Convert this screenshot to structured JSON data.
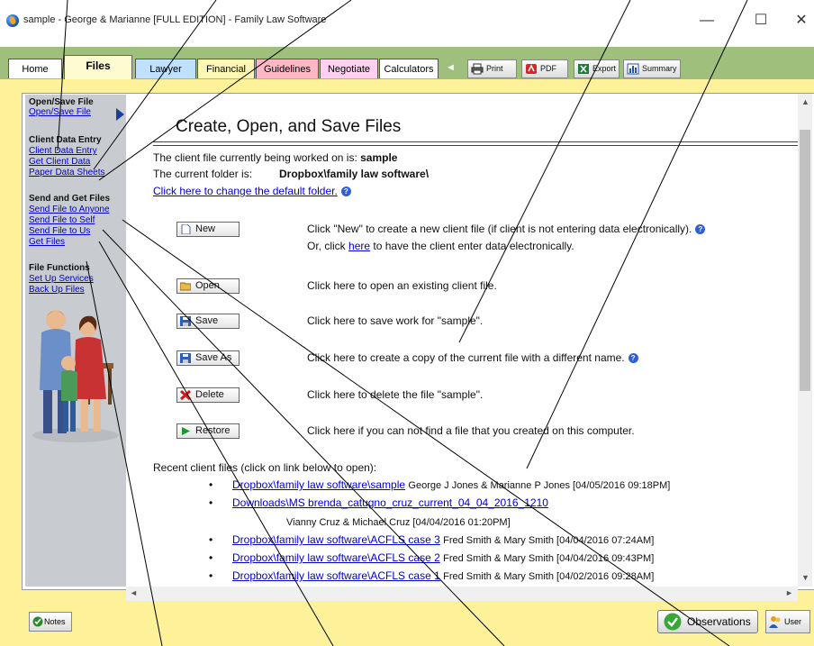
{
  "window": {
    "title": "sample - George & Marianne [FULL EDITION] - Family Law Software",
    "minimize_glyph": "—",
    "maximize_glyph": "☐",
    "close_glyph": "✕"
  },
  "tabs": [
    {
      "label": "Home",
      "color": "#ffffff"
    },
    {
      "label": "Files",
      "color": "#fffbd1"
    },
    {
      "label": "Lawyer",
      "color": "#bfe0ff"
    },
    {
      "label": "Financial",
      "color": "#fff8b5"
    },
    {
      "label": "Guidelines",
      "color": "#ffb7c5"
    },
    {
      "label": "Negotiate",
      "color": "#ffd0f0"
    },
    {
      "label": "Calculators",
      "color": "#ffffff"
    }
  ],
  "toolbar": {
    "nav_arrow": "◄",
    "print": "Print",
    "pdf": "PDF",
    "export": "Export",
    "summary": "Summary"
  },
  "sidebar": {
    "sections": [
      {
        "heading": "Open/Save File",
        "links": [
          "Open/Save File"
        ]
      },
      {
        "heading": "Client Data Entry",
        "links": [
          "Client Data Entry",
          "Get Client Data",
          "Paper Data Sheets"
        ]
      },
      {
        "heading": "Send and Get Files",
        "links": [
          "Send File to Anyone",
          "Send File to Self",
          "Send File to Us",
          "Get Files"
        ]
      },
      {
        "heading": "File Functions",
        "links": [
          "Set Up Services",
          "Back Up Files"
        ]
      }
    ]
  },
  "main": {
    "title": "Create, Open, and Save Files",
    "current_file_prefix": "The client file currently being worked on is: ",
    "current_file": "sample",
    "current_folder_prefix": "The current folder is:",
    "current_folder": "Dropbox\\family law software\\",
    "change_folder_link": "Click here to change the default folder.",
    "actions": [
      {
        "label": "New",
        "description": "Click \"New\" to create a new client file (if client is not entering data electronically).",
        "help": true
      },
      {
        "label": "Open",
        "description": "Click here to open an existing client file.",
        "help": false
      },
      {
        "label": "Save",
        "description": "Click here to save work for \"sample\".",
        "help": false
      },
      {
        "label": "Save As",
        "description": "Click here to create a copy of the current file with a different name.",
        "help": true
      },
      {
        "label": "Delete",
        "description": "Click here to delete the file \"sample\".",
        "help": false
      },
      {
        "label": "Restore",
        "description": "Click here if you can not find a file that you created on this computer.",
        "help": false
      }
    ],
    "new_or_prefix": "Or, click ",
    "new_or_link": "here",
    "new_or_suffix": " to have the client enter data electronically.",
    "recent_heading": "Recent client files (click on link below to open):",
    "recent_files": [
      {
        "link": "Dropbox\\family law software\\sample",
        "meta": "George J Jones & Marianne P Jones [04/05/2016 09:18PM]"
      },
      {
        "link": "Downloads\\MS brenda_catugno_cruz_current_04_04_2016_1210",
        "meta": "Vianny Cruz & Michael Cruz [04/04/2016 01:20PM]"
      },
      {
        "link": "Dropbox\\family law software\\ACFLS case 3",
        "meta": "Fred Smith & Mary Smith [04/04/2016 07:24AM]"
      },
      {
        "link": "Dropbox\\family law software\\ACFLS case 2",
        "meta": "Fred Smith & Mary Smith [04/04/2016 09:43PM]"
      },
      {
        "link": "Dropbox\\family law software\\ACFLS case 1",
        "meta": "Fred Smith & Mary Smith [04/02/2016 09:28AM]"
      }
    ],
    "help_glyph": "?"
  },
  "bottom": {
    "notes": "Notes",
    "observations": "Observations",
    "user": "User"
  },
  "colors": {
    "tabbar_bg": "#9fbf7c",
    "frame_bg": "#fdf29a",
    "sidebar_bg": "#c8ccd0",
    "link": "#0000cc"
  }
}
